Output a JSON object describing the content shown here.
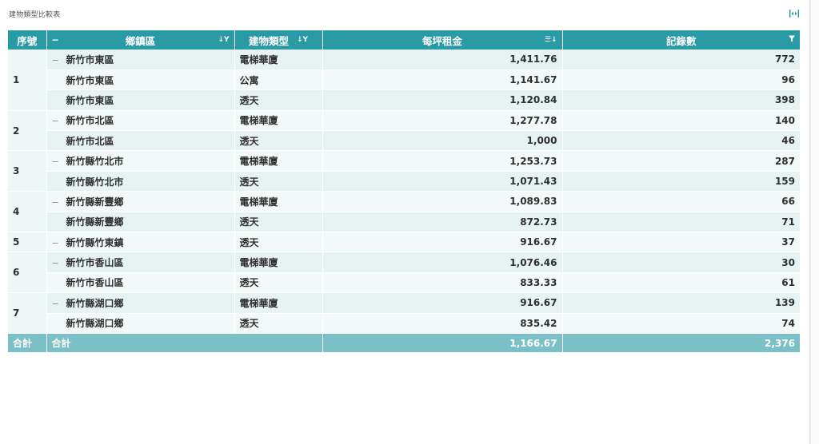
{
  "widget": {
    "title": "建物類型比較表"
  },
  "table": {
    "headers": {
      "seq": "序號",
      "district": "鄉鎮區",
      "type": "建物類型",
      "price": "每坪租金",
      "count": "記錄數"
    },
    "groups": [
      {
        "seq": "1",
        "rows": [
          {
            "district": "新竹市東區",
            "type": "電梯華廈",
            "price": "1,411.76",
            "count": "772"
          },
          {
            "district": "新竹市東區",
            "type": "公寓",
            "price": "1,141.67",
            "count": "96"
          },
          {
            "district": "新竹市東區",
            "type": "透天",
            "price": "1,120.84",
            "count": "398"
          }
        ]
      },
      {
        "seq": "2",
        "rows": [
          {
            "district": "新竹市北區",
            "type": "電梯華廈",
            "price": "1,277.78",
            "count": "140"
          },
          {
            "district": "新竹市北區",
            "type": "透天",
            "price": "1,000",
            "count": "46"
          }
        ]
      },
      {
        "seq": "3",
        "rows": [
          {
            "district": "新竹縣竹北市",
            "type": "電梯華廈",
            "price": "1,253.73",
            "count": "287"
          },
          {
            "district": "新竹縣竹北市",
            "type": "透天",
            "price": "1,071.43",
            "count": "159"
          }
        ]
      },
      {
        "seq": "4",
        "rows": [
          {
            "district": "新竹縣新豐鄉",
            "type": "電梯華廈",
            "price": "1,089.83",
            "count": "66"
          },
          {
            "district": "新竹縣新豐鄉",
            "type": "透天",
            "price": "872.73",
            "count": "71"
          }
        ]
      },
      {
        "seq": "5",
        "rows": [
          {
            "district": "新竹縣竹東鎮",
            "type": "透天",
            "price": "916.67",
            "count": "37"
          }
        ]
      },
      {
        "seq": "6",
        "rows": [
          {
            "district": "新竹市香山區",
            "type": "電梯華廈",
            "price": "1,076.46",
            "count": "30"
          },
          {
            "district": "新竹市香山區",
            "type": "透天",
            "price": "833.33",
            "count": "61"
          }
        ]
      },
      {
        "seq": "7",
        "rows": [
          {
            "district": "新竹縣湖口鄉",
            "type": "電梯華廈",
            "price": "916.67",
            "count": "139"
          },
          {
            "district": "新竹縣湖口鄉",
            "type": "透天",
            "price": "835.42",
            "count": "74"
          }
        ]
      }
    ],
    "total": {
      "seq": "合計",
      "label": "合計",
      "price": "1,166.67",
      "count": "2,376"
    }
  },
  "colors": {
    "header_bg": "#2a9aa4",
    "total_bg": "#7bc0c6",
    "row_alt": "#e7f2f3",
    "row_plain": "#f3f9f9"
  },
  "icons": {
    "expand": "expand-columns-icon",
    "sort": "sort-icon",
    "filter": "filter-icon",
    "collapse": "minus-icon"
  }
}
